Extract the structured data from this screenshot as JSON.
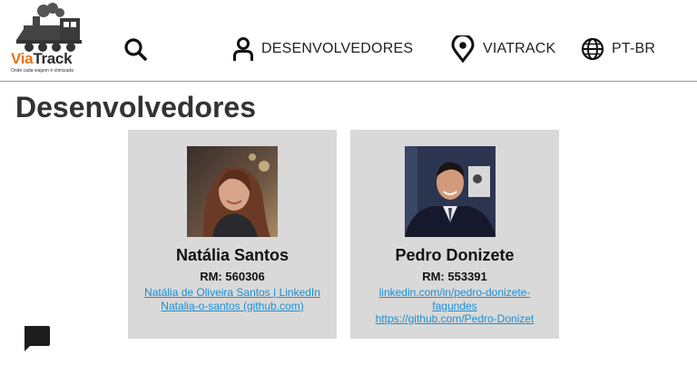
{
  "logo": {
    "brand_via": "Via",
    "brand_track": "Track",
    "tagline": "Onde cada viagem é otimizada"
  },
  "nav": {
    "developers": "DESENVOLVEDORES",
    "viatrack": "VIATRACK",
    "language": "PT-BR"
  },
  "page": {
    "title": "Desenvolvedores"
  },
  "developers": [
    {
      "name": "Natália Santos",
      "rm": "RM: 560306",
      "links": [
        "Natália de Oliveira Santos | LinkedIn",
        "Natalia-o-santos (github.com)"
      ]
    },
    {
      "name": "Pedro Donizete",
      "rm": "RM: 553391",
      "links": [
        "linkedin.com/in/pedro-donizete-",
        "fagundes",
        "https://github.com/Pedro-Donizet"
      ]
    }
  ],
  "colors": {
    "brand_orange": "#e8731a",
    "link": "#1a8fd6",
    "card_bg": "#d9d9d9"
  },
  "icons": [
    "train-logo-icon",
    "search-icon",
    "user-icon",
    "location-pin-icon",
    "globe-icon",
    "chat-icon"
  ]
}
